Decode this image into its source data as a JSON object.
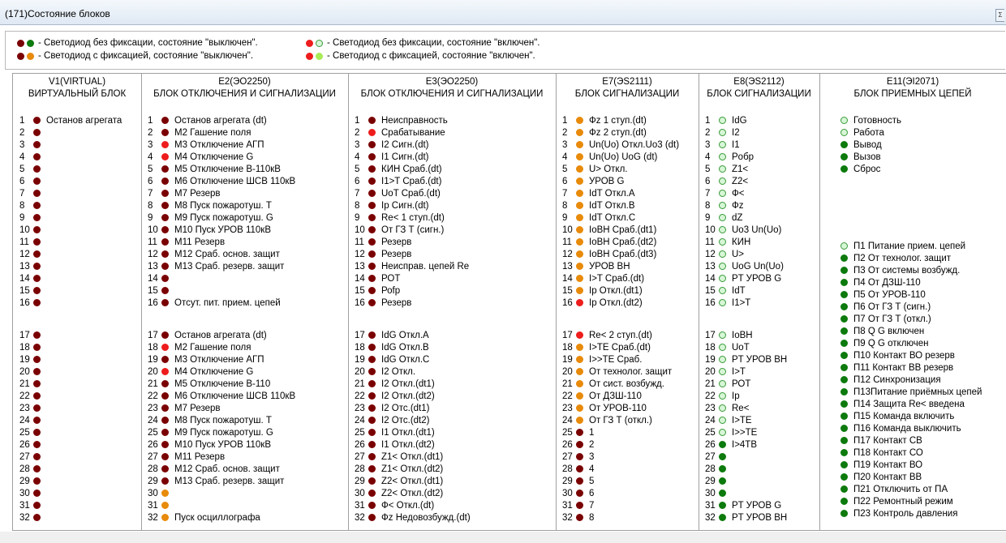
{
  "window": {
    "title": "(171)Состояние блоков",
    "close_glyph": "Σ"
  },
  "legend": [
    {
      "leds": [
        "dred",
        "dgreen"
      ],
      "text": "- Светодиод без фиксации, состояние \"выключен\"."
    },
    {
      "leds": [
        "bred",
        "lgreen"
      ],
      "text": "- Светодиод без фиксации, состояние \"включен\"."
    },
    {
      "leds": [
        "dred",
        "dorange"
      ],
      "text": "- Светодиод с фиксацией, состояние \"выключен\"."
    },
    {
      "leds": [
        "bred",
        "lgreen2"
      ],
      "text": "- Светодиод с фиксацией, состояние \"включен\"."
    }
  ],
  "blocks": [
    {
      "name": "V1(VIRTUAL)",
      "title": "ВИРТУАЛЬНЫЙ БЛОК",
      "numbered": true,
      "items": [
        {
          "n": "1",
          "led": "dred",
          "text": "Останов агрегата"
        },
        {
          "n": "2",
          "led": "dred",
          "text": ""
        },
        {
          "n": "3",
          "led": "dred",
          "text": ""
        },
        {
          "n": "4",
          "led": "dred",
          "text": ""
        },
        {
          "n": "5",
          "led": "dred",
          "text": ""
        },
        {
          "n": "6",
          "led": "dred",
          "text": ""
        },
        {
          "n": "7",
          "led": "dred",
          "text": ""
        },
        {
          "n": "8",
          "led": "dred",
          "text": ""
        },
        {
          "n": "9",
          "led": "dred",
          "text": ""
        },
        {
          "n": "10",
          "led": "dred",
          "text": ""
        },
        {
          "n": "11",
          "led": "dred",
          "text": ""
        },
        {
          "n": "12",
          "led": "dred",
          "text": ""
        },
        {
          "n": "13",
          "led": "dred",
          "text": ""
        },
        {
          "n": "14",
          "led": "dred",
          "text": ""
        },
        {
          "n": "15",
          "led": "dred",
          "text": ""
        },
        {
          "n": "16",
          "led": "dred",
          "text": ""
        },
        {
          "n": "17",
          "led": "dred",
          "text": ""
        },
        {
          "n": "18",
          "led": "dred",
          "text": ""
        },
        {
          "n": "19",
          "led": "dred",
          "text": ""
        },
        {
          "n": "20",
          "led": "dred",
          "text": ""
        },
        {
          "n": "21",
          "led": "dred",
          "text": ""
        },
        {
          "n": "22",
          "led": "dred",
          "text": ""
        },
        {
          "n": "23",
          "led": "dred",
          "text": ""
        },
        {
          "n": "24",
          "led": "dred",
          "text": ""
        },
        {
          "n": "25",
          "led": "dred",
          "text": ""
        },
        {
          "n": "26",
          "led": "dred",
          "text": ""
        },
        {
          "n": "27",
          "led": "dred",
          "text": ""
        },
        {
          "n": "28",
          "led": "dred",
          "text": ""
        },
        {
          "n": "29",
          "led": "dred",
          "text": ""
        },
        {
          "n": "30",
          "led": "dred",
          "text": ""
        },
        {
          "n": "31",
          "led": "dred",
          "text": ""
        },
        {
          "n": "32",
          "led": "dred",
          "text": ""
        }
      ]
    },
    {
      "name": "E2(ЭО2250)",
      "title": "БЛОК ОТКЛЮЧЕНИЯ И СИГНАЛИЗАЦИИ",
      "numbered": true,
      "items": [
        {
          "n": "1",
          "led": "dred",
          "text": "Останов агрегата (dt)"
        },
        {
          "n": "2",
          "led": "dred",
          "text": "М2 Гашение поля"
        },
        {
          "n": "3",
          "led": "bred",
          "text": "М3 Отключение АГП"
        },
        {
          "n": "4",
          "led": "bred",
          "text": "М4 Отключение G"
        },
        {
          "n": "5",
          "led": "dred",
          "text": "М5 Отключение В-110кВ"
        },
        {
          "n": "6",
          "led": "dred",
          "text": "М6 Отключение ШСВ 110кВ"
        },
        {
          "n": "7",
          "led": "dred",
          "text": "М7 Резерв"
        },
        {
          "n": "8",
          "led": "dred",
          "text": "М8 Пуск пожаротуш. Т"
        },
        {
          "n": "9",
          "led": "dred",
          "text": "М9 Пуск пожаротуш. G"
        },
        {
          "n": "10",
          "led": "dred",
          "text": "М10 Пуск УРОВ 110кВ"
        },
        {
          "n": "11",
          "led": "dred",
          "text": "М11 Резерв"
        },
        {
          "n": "12",
          "led": "dred",
          "text": "М12 Сраб. основ. защит"
        },
        {
          "n": "13",
          "led": "dred",
          "text": "М13 Сраб. резерв. защит"
        },
        {
          "n": "14",
          "led": "dred",
          "text": ""
        },
        {
          "n": "15",
          "led": "dred",
          "text": ""
        },
        {
          "n": "16",
          "led": "dred",
          "text": "Отсут. пит. прием. цепей"
        },
        {
          "n": "17",
          "led": "dred",
          "text": "Останов агрегата (dt)"
        },
        {
          "n": "18",
          "led": "bred",
          "text": "М2 Гашение поля"
        },
        {
          "n": "19",
          "led": "dred",
          "text": "М3 Отключение АГП"
        },
        {
          "n": "20",
          "led": "bred",
          "text": "М4 Отключение G"
        },
        {
          "n": "21",
          "led": "dred",
          "text": "М5 Отключение В-110"
        },
        {
          "n": "22",
          "led": "dred",
          "text": "М6 Отключение ШСВ 110кВ"
        },
        {
          "n": "23",
          "led": "dred",
          "text": "М7 Резерв"
        },
        {
          "n": "24",
          "led": "dred",
          "text": "М8 Пуск пожаротуш. Т"
        },
        {
          "n": "25",
          "led": "dred",
          "text": "М9 Пуск пожаротуш. G"
        },
        {
          "n": "26",
          "led": "dred",
          "text": "М10 Пуск УРОВ 110кВ"
        },
        {
          "n": "27",
          "led": "dred",
          "text": "М11 Резерв"
        },
        {
          "n": "28",
          "led": "dred",
          "text": "М12 Сраб. основ. защит"
        },
        {
          "n": "29",
          "led": "dred",
          "text": "М13 Сраб. резерв. защит"
        },
        {
          "n": "30",
          "led": "dorange",
          "text": ""
        },
        {
          "n": "31",
          "led": "dorange",
          "text": ""
        },
        {
          "n": "32",
          "led": "dorange",
          "text": "Пуск осциллографа"
        }
      ]
    },
    {
      "name": "E3(ЭО2250)",
      "title": "БЛОК ОТКЛЮЧЕНИЯ И СИГНАЛИЗАЦИИ",
      "numbered": true,
      "items": [
        {
          "n": "1",
          "led": "dred",
          "text": "Неисправность"
        },
        {
          "n": "2",
          "led": "bred",
          "text": "Срабатывание"
        },
        {
          "n": "3",
          "led": "dred",
          "text": "I2 Сигн.(dt)"
        },
        {
          "n": "4",
          "led": "dred",
          "text": "I1 Сигн.(dt)"
        },
        {
          "n": "5",
          "led": "dred",
          "text": "КИН Сраб.(dt)"
        },
        {
          "n": "6",
          "led": "dred",
          "text": "I1>T Сраб.(dt)"
        },
        {
          "n": "7",
          "led": "dred",
          "text": "UoT Сраб.(dt)"
        },
        {
          "n": "8",
          "led": "dred",
          "text": "Ip Сигн.(dt)"
        },
        {
          "n": "9",
          "led": "dred",
          "text": "Re< 1 ступ.(dt)"
        },
        {
          "n": "10",
          "led": "dred",
          "text": "От ГЗ Т (сигн.)"
        },
        {
          "n": "11",
          "led": "dred",
          "text": "Резерв"
        },
        {
          "n": "12",
          "led": "dred",
          "text": "Резерв"
        },
        {
          "n": "13",
          "led": "dred",
          "text": "Неисправ. цепей Re"
        },
        {
          "n": "14",
          "led": "dred",
          "text": "РОТ"
        },
        {
          "n": "15",
          "led": "dred",
          "text": "Роfр"
        },
        {
          "n": "16",
          "led": "dred",
          "text": "Резерв"
        },
        {
          "n": "17",
          "led": "dred",
          "text": "IdG Откл.А"
        },
        {
          "n": "18",
          "led": "dred",
          "text": "IdG Откл.B"
        },
        {
          "n": "19",
          "led": "dred",
          "text": "IdG Откл.С"
        },
        {
          "n": "20",
          "led": "dred",
          "text": "I2 Откл."
        },
        {
          "n": "21",
          "led": "dred",
          "text": "I2 Откл.(dt1)"
        },
        {
          "n": "22",
          "led": "dred",
          "text": "I2 Откл.(dt2)"
        },
        {
          "n": "23",
          "led": "dred",
          "text": "I2 Отс.(dt1)"
        },
        {
          "n": "24",
          "led": "dred",
          "text": "I2 Отс.(dt2)"
        },
        {
          "n": "25",
          "led": "dred",
          "text": "I1 Откл.(dt1)"
        },
        {
          "n": "26",
          "led": "dred",
          "text": "I1 Откл.(dt2)"
        },
        {
          "n": "27",
          "led": "dred",
          "text": "Z1< Откл.(dt1)"
        },
        {
          "n": "28",
          "led": "dred",
          "text": "Z1< Откл.(dt2)"
        },
        {
          "n": "29",
          "led": "dred",
          "text": "Z2< Откл.(dt1)"
        },
        {
          "n": "30",
          "led": "dred",
          "text": "Z2< Откл.(dt2)"
        },
        {
          "n": "31",
          "led": "dred",
          "text": "Ф< Откл.(dt)"
        },
        {
          "n": "32",
          "led": "dred",
          "text": "Фz Недовозбужд.(dt)"
        }
      ]
    },
    {
      "name": "E7(ЭS2111)",
      "title": "БЛОК СИГНАЛИЗАЦИИ",
      "numbered": true,
      "items": [
        {
          "n": "1",
          "led": "dorange",
          "text": "Фz 1 ступ.(dt)"
        },
        {
          "n": "2",
          "led": "dorange",
          "text": "Фz 2 ступ.(dt)"
        },
        {
          "n": "3",
          "led": "dorange",
          "text": "Un(Uo) Откл.Uo3 (dt)"
        },
        {
          "n": "4",
          "led": "dorange",
          "text": "Un(Uo) UoG (dt)"
        },
        {
          "n": "5",
          "led": "dorange",
          "text": "U> Откл."
        },
        {
          "n": "6",
          "led": "dorange",
          "text": "УРОВ G"
        },
        {
          "n": "7",
          "led": "dorange",
          "text": "IdT Откл.А"
        },
        {
          "n": "8",
          "led": "dorange",
          "text": "IdT Откл.B"
        },
        {
          "n": "9",
          "led": "dorange",
          "text": "IdT Откл.С"
        },
        {
          "n": "10",
          "led": "dorange",
          "text": "IoBH Сраб.(dt1)"
        },
        {
          "n": "11",
          "led": "dorange",
          "text": "IoBH Сраб.(dt2)"
        },
        {
          "n": "12",
          "led": "dorange",
          "text": "IoBH Сраб.(dt3)"
        },
        {
          "n": "13",
          "led": "dorange",
          "text": "УРОВ ВН"
        },
        {
          "n": "14",
          "led": "dorange",
          "text": "I>T Сраб.(dt)"
        },
        {
          "n": "15",
          "led": "dorange",
          "text": "Ip Откл.(dt1)"
        },
        {
          "n": "16",
          "led": "bred",
          "text": "Ip Откл.(dt2)"
        },
        {
          "n": "17",
          "led": "bred",
          "text": "Re< 2 ступ.(dt)"
        },
        {
          "n": "18",
          "led": "dorange",
          "text": "I>TE Сраб.(dt)"
        },
        {
          "n": "19",
          "led": "dorange",
          "text": "I>>TE Сраб."
        },
        {
          "n": "20",
          "led": "dorange",
          "text": "От технолог. защит"
        },
        {
          "n": "21",
          "led": "dorange",
          "text": "От сист. возбужд."
        },
        {
          "n": "22",
          "led": "dorange",
          "text": "От ДЗШ-110"
        },
        {
          "n": "23",
          "led": "dorange",
          "text": "От УРОВ-110"
        },
        {
          "n": "24",
          "led": "dorange",
          "text": "От ГЗ Т (откл.)"
        },
        {
          "n": "25",
          "led": "dred",
          "text": "1"
        },
        {
          "n": "26",
          "led": "dred",
          "text": "2"
        },
        {
          "n": "27",
          "led": "dred",
          "text": "3"
        },
        {
          "n": "28",
          "led": "dred",
          "text": "4"
        },
        {
          "n": "29",
          "led": "dred",
          "text": "5"
        },
        {
          "n": "30",
          "led": "dred",
          "text": "6"
        },
        {
          "n": "31",
          "led": "dred",
          "text": "7"
        },
        {
          "n": "32",
          "led": "dred",
          "text": "8"
        }
      ]
    },
    {
      "name": "E8(ЭS2112)",
      "title": "БЛОК СИГНАЛИЗАЦИИ",
      "numbered": true,
      "items": [
        {
          "n": "1",
          "led": "lgreen",
          "text": "IdG"
        },
        {
          "n": "2",
          "led": "lgreen",
          "text": "I2"
        },
        {
          "n": "3",
          "led": "lgreen",
          "text": "I1"
        },
        {
          "n": "4",
          "led": "lgreen",
          "text": "Pобр"
        },
        {
          "n": "5",
          "led": "lgreen",
          "text": "Z1<"
        },
        {
          "n": "6",
          "led": "lgreen",
          "text": "Z2<"
        },
        {
          "n": "7",
          "led": "lgreen",
          "text": "Ф<"
        },
        {
          "n": "8",
          "led": "lgreen",
          "text": "Фz"
        },
        {
          "n": "9",
          "led": "lgreen",
          "text": "dZ"
        },
        {
          "n": "10",
          "led": "lgreen",
          "text": "Uo3 Un(Uo)"
        },
        {
          "n": "11",
          "led": "lgreen",
          "text": "КИН"
        },
        {
          "n": "12",
          "led": "lgreen",
          "text": "U>"
        },
        {
          "n": "13",
          "led": "lgreen",
          "text": "UoG Un(Uo)"
        },
        {
          "n": "14",
          "led": "lgreen",
          "text": "PT УРОВ G"
        },
        {
          "n": "15",
          "led": "lgreen",
          "text": "IdT"
        },
        {
          "n": "16",
          "led": "lgreen",
          "text": "I1>T"
        },
        {
          "n": "17",
          "led": "lgreen",
          "text": "IoBH"
        },
        {
          "n": "18",
          "led": "lgreen",
          "text": "UoT"
        },
        {
          "n": "19",
          "led": "lgreen",
          "text": "PT УРОВ ВН"
        },
        {
          "n": "20",
          "led": "lgreen",
          "text": "I>T"
        },
        {
          "n": "21",
          "led": "lgreen",
          "text": "РОТ"
        },
        {
          "n": "22",
          "led": "lgreen",
          "text": "Ip"
        },
        {
          "n": "23",
          "led": "lgreen",
          "text": "Re<"
        },
        {
          "n": "24",
          "led": "lgreen",
          "text": "I>TE"
        },
        {
          "n": "25",
          "led": "lgreen",
          "text": "I>>TE"
        },
        {
          "n": "26",
          "led": "dgreen",
          "text": "I>4TB"
        },
        {
          "n": "27",
          "led": "dgreen",
          "text": ""
        },
        {
          "n": "28",
          "led": "dgreen",
          "text": ""
        },
        {
          "n": "29",
          "led": "dgreen",
          "text": ""
        },
        {
          "n": "30",
          "led": "dgreen",
          "text": ""
        },
        {
          "n": "31",
          "led": "dgreen",
          "text": "PT УРОВ G"
        },
        {
          "n": "32",
          "led": "dgreen",
          "text": "PT УРОВ ВН"
        }
      ]
    },
    {
      "name": "E11(ЭI2071)",
      "title": "БЛОК ПРИЕМНЫХ ЦЕПЕЙ",
      "numbered": false,
      "items": [
        {
          "led": "lgreen",
          "text": "Готовность"
        },
        {
          "led": "lgreen",
          "text": "Работа"
        },
        {
          "led": "dgreen",
          "text": "Вывод"
        },
        {
          "led": "dgreen",
          "text": "Вызов"
        },
        {
          "led": "dgreen",
          "text": "Сброс"
        },
        {
          "led": "lgreen",
          "text": "П1 Питание прием. цепей"
        },
        {
          "led": "dgreen",
          "text": "П2 От технолог. защит"
        },
        {
          "led": "dgreen",
          "text": "П3 От системы возбужд."
        },
        {
          "led": "dgreen",
          "text": "П4 От ДЗШ-110"
        },
        {
          "led": "dgreen",
          "text": "П5 От УРОВ-110"
        },
        {
          "led": "dgreen",
          "text": "П6 От ГЗ Т (сигн.)"
        },
        {
          "led": "dgreen",
          "text": "П7 От ГЗ Т (откл.)"
        },
        {
          "led": "dgreen",
          "text": "П8 Q G включен"
        },
        {
          "led": "dgreen",
          "text": "П9 Q G отключен"
        },
        {
          "led": "dgreen",
          "text": "П10 Контакт ВО резерв"
        },
        {
          "led": "dgreen",
          "text": "П11 Контакт ВВ резерв"
        },
        {
          "led": "dgreen",
          "text": "П12 Синхронизация"
        },
        {
          "led": "dgreen",
          "text": "П13Питание приёмных цепей"
        },
        {
          "led": "dgreen",
          "text": "П14 Защита Re< введена"
        },
        {
          "led": "dgreen",
          "text": "П15 Команда включить"
        },
        {
          "led": "dgreen",
          "text": "П16 Команда выключить"
        },
        {
          "led": "dgreen",
          "text": "П17 Контакт СВ"
        },
        {
          "led": "dgreen",
          "text": "П18 Контакт СО"
        },
        {
          "led": "dgreen",
          "text": "П19 Контакт ВО"
        },
        {
          "led": "dgreen",
          "text": "П20 Контакт ВВ"
        },
        {
          "led": "dgreen",
          "text": "П21 Отключить от ПА"
        },
        {
          "led": "dgreen",
          "text": "П22 Ремонтный режим"
        },
        {
          "led": "dgreen",
          "text": "П23 Контроль давления"
        }
      ]
    }
  ]
}
